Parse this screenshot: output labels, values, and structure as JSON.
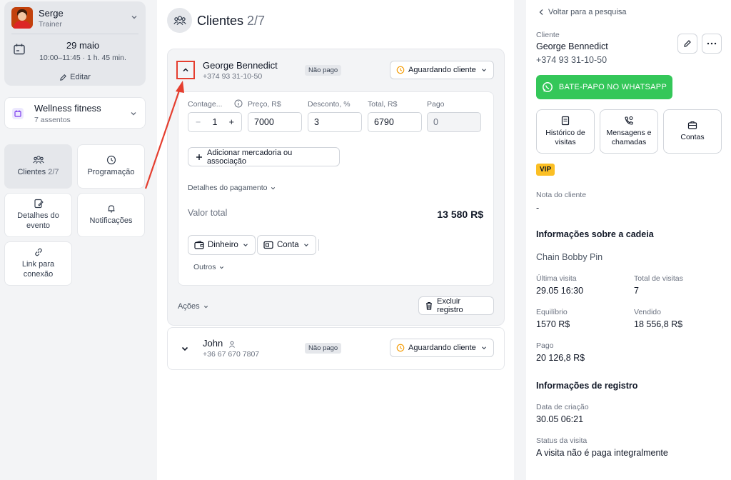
{
  "trainer": {
    "name": "Serge",
    "role": "Trainer",
    "date": "29 maio",
    "time": "10:00–11:45 · 1 h. 45 min.",
    "edit_label": "Editar"
  },
  "gym": {
    "name": "Wellness fitness",
    "seats": "7 assentos"
  },
  "nav": {
    "clients_label": "Clientes",
    "clients_count": "2/7",
    "schedule": "Programação",
    "event_details_line1": "Detalhes do",
    "event_details_line2": "evento",
    "notifications": "Notificações",
    "link_line1": "Link para",
    "link_line2": "conexão"
  },
  "main": {
    "title": "Clientes",
    "count": "2/7",
    "client1": {
      "name": "George Bennedict",
      "phone": "+374 93 31-10-50",
      "payment_badge": "Não pago",
      "status": "Aguardando cliente",
      "labels": {
        "count": "Contage...",
        "price": "Preço, R$",
        "discount": "Desconto, %",
        "total": "Total, R$",
        "paid": "Pago"
      },
      "values": {
        "minus": "−",
        "count": "1",
        "plus": "+",
        "price": "7000",
        "discount": "3",
        "total": "6790",
        "paid": "0"
      },
      "add_item": "Adicionar mercadoria ou associação",
      "payment_details": "Detalhes do pagamento",
      "total_label": "Valor total",
      "total_value": "13 580 R$",
      "pay_cash": "Dinheiro",
      "pay_account": "Conta",
      "others": "Outros",
      "actions": "Ações",
      "delete": "Excluir registro"
    },
    "client2": {
      "name": "John",
      "phone": "+36 67 670 7807",
      "payment_badge": "Não pago",
      "status": "Aguardando cliente"
    }
  },
  "panel": {
    "back": "Voltar para a pesquisa",
    "client_label": "Cliente",
    "client_name": "George Bennedict",
    "client_phone": "+374 93 31-10-50",
    "whatsapp": "BATE-PAPO NO WHATSAPP",
    "tiles": {
      "history_line1": "Histórico de",
      "history_line2": "visitas",
      "messages_line1": "Mensagens e",
      "messages_line2": "chamadas",
      "accounts": "Contas"
    },
    "vip": "VIP",
    "note_label": "Nota do cliente",
    "note_value": "-",
    "chain_heading": "Informações sobre a cadeia",
    "chain_name": "Chain Bobby Pin",
    "last_visit_label": "Última visita",
    "last_visit_value": "29.05 16:30",
    "total_visits_label": "Total de visitas",
    "total_visits_value": "7",
    "balance_label": "Equilíbrio",
    "balance_value": "1570 R$",
    "sold_label": "Vendido",
    "sold_value": "18 556,8 R$",
    "paid_label": "Pago",
    "paid_value": "20 126,8 R$",
    "reg_heading": "Informações de registro",
    "created_label": "Data de criação",
    "created_value": "30.05 06:21",
    "visit_status_label": "Status da visita",
    "visit_status_value": "A visita não é paga integralmente"
  },
  "colors": {
    "accent_red": "#e53e2f",
    "whatsapp_green": "#34c759",
    "vip_yellow": "#fbbf24"
  }
}
